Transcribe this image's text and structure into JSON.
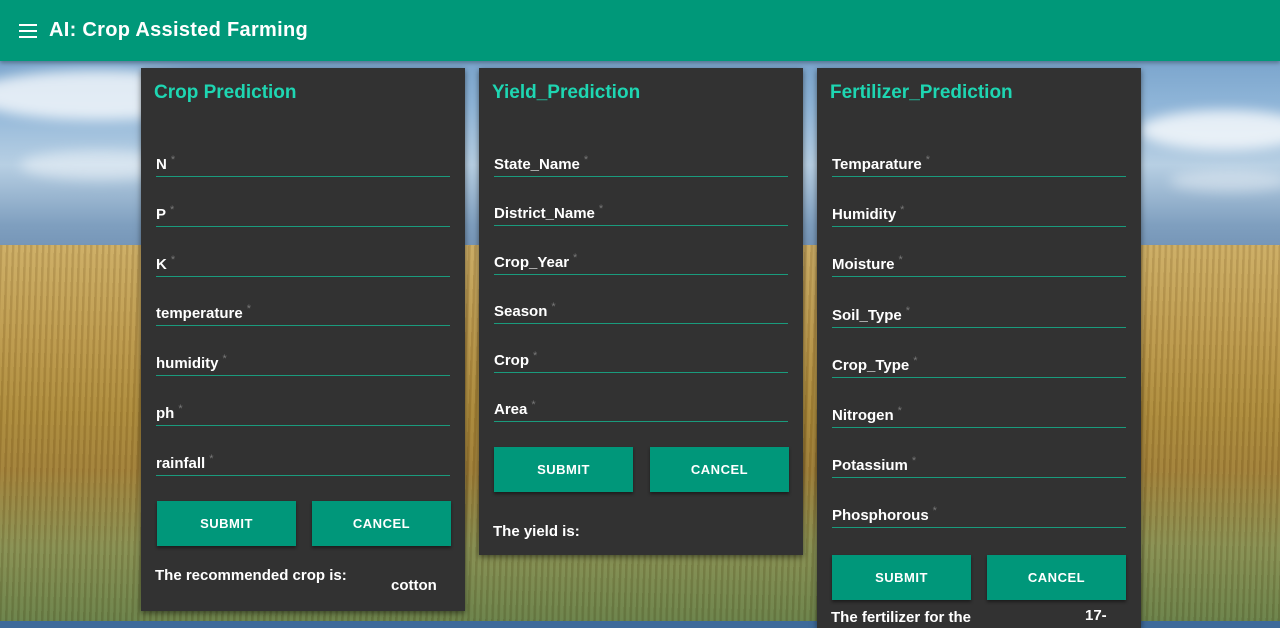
{
  "app": {
    "title": "AI: Crop Assisted Farming"
  },
  "crop_card": {
    "title": "Crop Prediction",
    "fields": [
      "N",
      "P",
      "K",
      "temperature",
      "humidity",
      "ph",
      "rainfall"
    ],
    "submit_label": "SUBMIT",
    "cancel_label": "CANCEL",
    "result_label": "The recommended crop is:",
    "result_value": "cotton"
  },
  "yield_card": {
    "title": "Yield_Prediction",
    "fields": [
      "State_Name",
      "District_Name",
      "Crop_Year",
      "Season",
      "Crop",
      "Area"
    ],
    "submit_label": "SUBMIT",
    "cancel_label": "CANCEL",
    "result_label": "The yield is:"
  },
  "fertilizer_card": {
    "title": "Fertilizer_Prediction",
    "fields": [
      "Temparature",
      "Humidity",
      "Moisture",
      "Soil_Type",
      "Crop_Type",
      "Nitrogen",
      "Potassium",
      "Phosphorous"
    ],
    "submit_label": "SUBMIT",
    "cancel_label": "CANCEL",
    "result_label": "The fertilizer for the",
    "result_value": "17-"
  },
  "required_marker": "*",
  "colors": {
    "appbar": "#009879",
    "accent": "#1ed6b2",
    "card": "#323232",
    "button": "#00977a"
  }
}
